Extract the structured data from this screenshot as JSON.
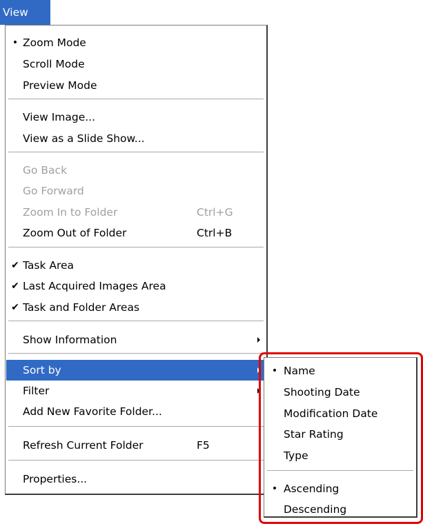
{
  "menubar": {
    "view_label": "View"
  },
  "view_menu": {
    "mode_items": [
      {
        "label": "Zoom Mode",
        "mark": "•"
      },
      {
        "label": "Scroll Mode",
        "mark": ""
      },
      {
        "label": "Preview Mode",
        "mark": ""
      }
    ],
    "view_items": [
      {
        "label": "View Image..."
      },
      {
        "label": "View as a Slide Show..."
      }
    ],
    "nav_items": [
      {
        "label": "Go Back",
        "shortcut": "",
        "disabled": true
      },
      {
        "label": "Go Forward",
        "shortcut": "",
        "disabled": true
      },
      {
        "label": "Zoom In to Folder",
        "shortcut": "Ctrl+G",
        "disabled": true
      },
      {
        "label": "Zoom Out of Folder",
        "shortcut": "Ctrl+B",
        "disabled": false
      }
    ],
    "area_items": [
      {
        "label": "Task Area",
        "mark": "✔"
      },
      {
        "label": "Last Acquired Images Area",
        "mark": "✔"
      },
      {
        "label": "Task and Folder Areas",
        "mark": "✔"
      }
    ],
    "show_information": {
      "label": "Show Information"
    },
    "sort_items": [
      {
        "label": "Sort by",
        "selected": true,
        "submenu": true
      },
      {
        "label": "Filter",
        "selected": false,
        "submenu": true
      },
      {
        "label": "Add New Favorite Folder...",
        "selected": false,
        "submenu": false
      }
    ],
    "refresh": {
      "label": "Refresh Current Folder",
      "shortcut": "F5"
    },
    "properties": {
      "label": "Properties..."
    }
  },
  "sort_submenu": {
    "sort_keys": [
      {
        "label": "Name",
        "mark": "•"
      },
      {
        "label": "Shooting Date",
        "mark": ""
      },
      {
        "label": "Modification Date",
        "mark": ""
      },
      {
        "label": "Star Rating",
        "mark": ""
      },
      {
        "label": "Type",
        "mark": ""
      }
    ],
    "order": [
      {
        "label": "Ascending",
        "mark": "•"
      },
      {
        "label": "Descending",
        "mark": ""
      }
    ]
  },
  "colors": {
    "selection": "#316ac5",
    "highlight_frame": "#e00000",
    "disabled_text": "#a0a0a0"
  }
}
